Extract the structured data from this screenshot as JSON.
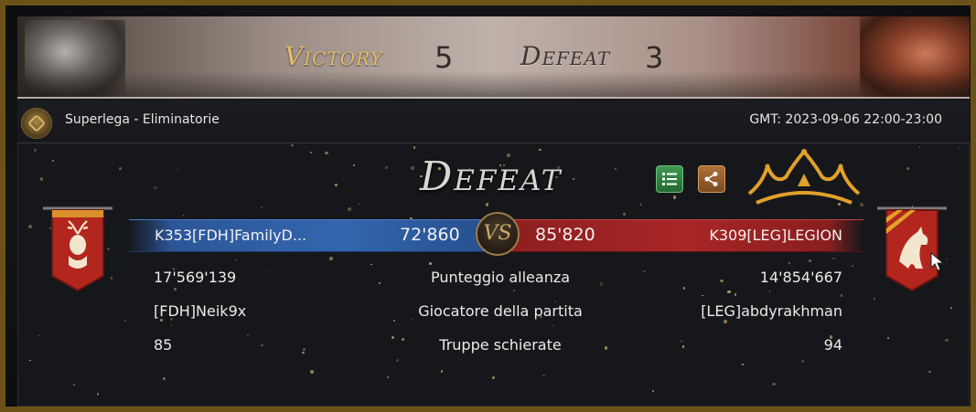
{
  "scoreboard": {
    "victory_label": "Victory",
    "victory_count": "5",
    "defeat_label": "Defeat",
    "defeat_count": "3"
  },
  "header": {
    "league": "Superlega - Eliminatorie",
    "gmt": "GMT: 2023-09-06 22:00-23:00"
  },
  "result": {
    "title": "Defeat"
  },
  "match": {
    "left_team": "K353[FDH]FamilyD...",
    "left_score": "72'860",
    "vs": "VS",
    "right_score": "85'820",
    "right_team": "K309[LEG]LEGION"
  },
  "stats": [
    {
      "left": "17'569'139",
      "label": "Punteggio alleanza",
      "right": "14'854'667"
    },
    {
      "left": "[FDH]Neik9x",
      "label": "Giocatore della partita",
      "right": "[LEG]abdyrakhman"
    },
    {
      "left": "85",
      "label": "Truppe schierate",
      "right": "94"
    }
  ],
  "icons": {
    "details": "list-icon",
    "share": "share-icon",
    "winner": "crown-icon",
    "left_emblem": "stag-banner-icon",
    "right_emblem": "wolf-banner-icon"
  },
  "colors": {
    "frame": "#6b5317",
    "victory": "#e3bd6a",
    "blue_team": "#3366ad",
    "red_team": "#a82626",
    "crown": "#e0a02a"
  }
}
